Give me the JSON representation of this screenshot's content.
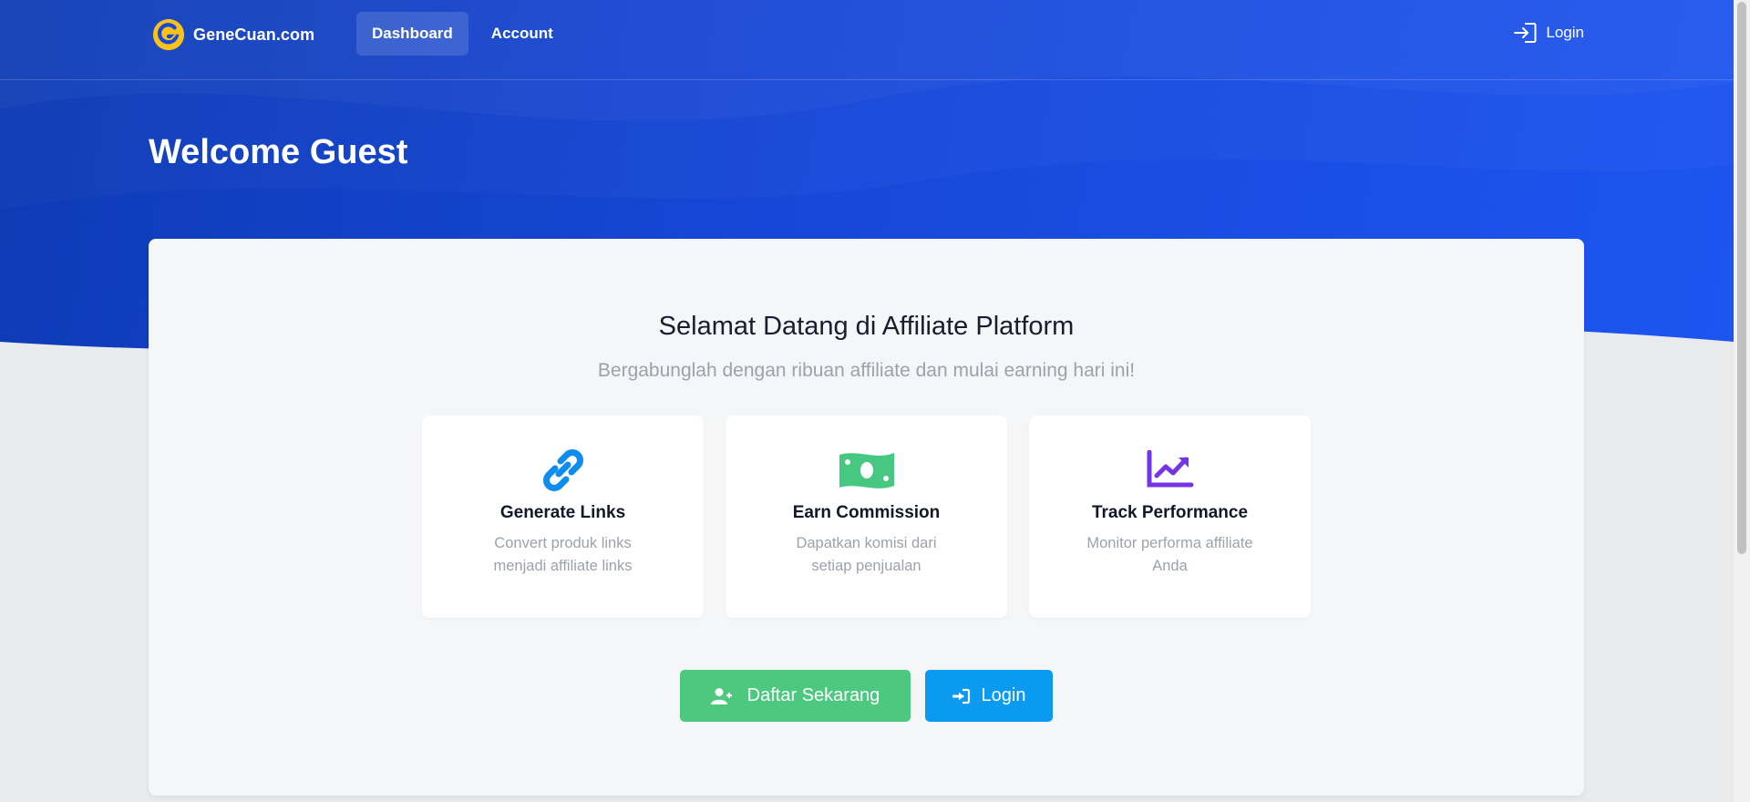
{
  "header": {
    "brand": "GeneCuan.com",
    "nav": [
      {
        "label": "Dashboard",
        "active": true
      },
      {
        "label": "Account",
        "active": false
      }
    ],
    "login_label": "Login"
  },
  "hero": {
    "title": "Welcome Guest"
  },
  "main": {
    "title": "Selamat Datang di Affiliate Platform",
    "subtitle": "Bergabunglah dengan ribuan affiliate dan mulai earning hari ini!",
    "features": [
      {
        "icon": "link-icon",
        "title": "Generate Links",
        "description": "Convert produk links menjadi affiliate links",
        "color": "#0f8cf0"
      },
      {
        "icon": "money-bill-icon",
        "title": "Earn Commission",
        "description": "Dapatkan komisi dari setiap penjualan",
        "color": "#46c882"
      },
      {
        "icon": "chart-line-icon",
        "title": "Track Performance",
        "description": "Monitor performa affiliate Anda",
        "color": "#7435e6"
      }
    ],
    "actions": {
      "register_label": "Daftar Sekarang",
      "login_label": "Login"
    }
  },
  "colors": {
    "hero_blue": "#1747d8",
    "brand_yellow": "#f7c21c",
    "register_green": "#4cc97f",
    "login_blue": "#0a9af0"
  }
}
